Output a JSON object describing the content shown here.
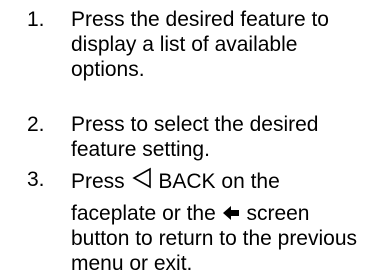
{
  "steps": [
    {
      "number": "1.",
      "lines": [
        "Press the desired feature to",
        "display a list of available",
        "options."
      ]
    },
    {
      "number": "2.",
      "lines": [
        "Press to select the desired",
        "feature setting."
      ]
    },
    {
      "number": "3.",
      "line1_prefix": "Press",
      "line1_suffix": "BACK on the",
      "line2_prefix": "faceplate or the",
      "line2_suffix": "screen",
      "line3": "button to return to the previous",
      "line4": "menu or exit.",
      "back_icon": "back-triangle-icon",
      "screen_back_icon": "back-arrow-icon"
    }
  ]
}
